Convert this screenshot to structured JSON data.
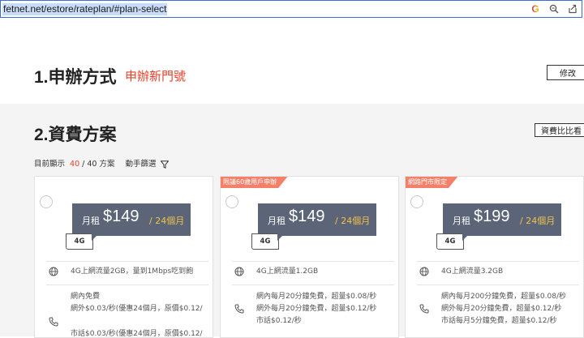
{
  "browser": {
    "url": "fetnet.net/estore/rateplan/#plan-select",
    "icons": [
      "google-icon",
      "zoom-icon",
      "share-icon"
    ]
  },
  "section1": {
    "title": "1.申辦方式",
    "subtitle": "申辦新門號",
    "edit_label": "修改"
  },
  "section2": {
    "title": "2.資費方案",
    "compare_label": "資費比比看",
    "count_prefix": "目前顯示",
    "count_shown": "40",
    "count_total": "/ 40 方案",
    "filter_label": "動手篩選"
  },
  "colors": {
    "accent_red": "#e7402b",
    "price_box": "#5b6577",
    "price_period": "#f3c24a",
    "ribbon": "#f4806a"
  },
  "plans": [
    {
      "ribbon": "",
      "price_label": "月租",
      "price": "$149",
      "period": "/ 24個月",
      "network": "4G",
      "data_line": "4G上網流量2GB，量到1Mbps吃到飽",
      "voice_lines": [
        "網內免費",
        "網外$0.03/秒(優惠24個月，原價$0.12/",
        "市話$0.03/秒(優惠24個月，原價$0.12/"
      ]
    },
    {
      "ribbon": "限議60歲用戶申辦",
      "price_label": "月租",
      "price": "$149",
      "period": "/ 24個月",
      "network": "4G",
      "data_line": "4G上網流量1.2GB",
      "voice_lines": [
        "網內每月20分鐘免費，超量$0.08/秒",
        "網外每月20分鐘免費，超量$0.12/秒",
        "市話$0.12/秒"
      ]
    },
    {
      "ribbon": "網路門市限定",
      "price_label": "月租",
      "price": "$199",
      "period": "/ 24個月",
      "network": "4G",
      "data_line": "4G上網流量3.2GB",
      "voice_lines": [
        "網內每月200分鐘免費，超量$0.08/秒",
        "網外每月20分鐘免費，超量$0.12/秒",
        "市話每月5分鐘免費，超量$0.12/秒"
      ]
    }
  ]
}
